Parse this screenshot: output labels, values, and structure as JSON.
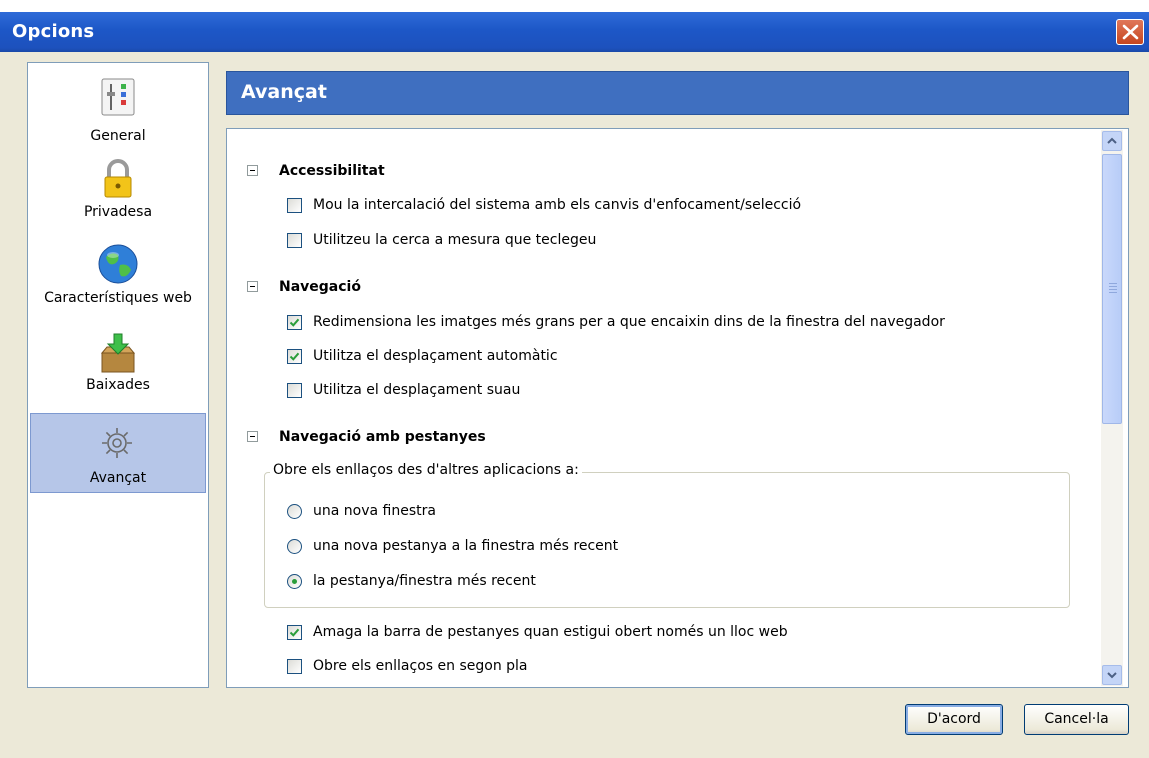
{
  "window": {
    "title": "Opcions"
  },
  "sidebar": {
    "items": [
      {
        "label": "General",
        "icon": "sliders-icon"
      },
      {
        "label": "Privadesa",
        "icon": "padlock-icon"
      },
      {
        "label": "Característiques web",
        "icon": "globe-icon"
      },
      {
        "label": "Baixades",
        "icon": "download-box-icon"
      },
      {
        "label": "Avançat",
        "icon": "gears-icon",
        "selected": true
      }
    ]
  },
  "panel": {
    "title": "Avançat",
    "sections": [
      {
        "heading": "Accessibilitat",
        "options": [
          {
            "label": "Mou la intercalació del sistema amb els canvis d'enfocament/selecció",
            "checked": false
          },
          {
            "label": "Utilitzeu la cerca a mesura que teclegeu",
            "checked": false
          }
        ]
      },
      {
        "heading": "Navegació",
        "options": [
          {
            "label": "Redimensiona les imatges més grans per a que encaixin dins de la finestra del navegador",
            "checked": true
          },
          {
            "label": "Utilitza el desplaçament automàtic",
            "checked": true
          },
          {
            "label": "Utilitza el desplaçament suau",
            "checked": false
          }
        ]
      },
      {
        "heading": "Navegació amb pestanyes",
        "group": {
          "legend": "Obre els enllaços des d'altres aplicacions a:",
          "options": [
            {
              "label": "una nova finestra",
              "selected": false
            },
            {
              "label": "una nova pestanya a la finestra més recent",
              "selected": false
            },
            {
              "label": "la pestanya/finestra més recent",
              "selected": true
            }
          ]
        },
        "options": [
          {
            "label": "Amaga la barra de pestanyes quan estigui obert només un lloc web",
            "checked": true
          },
          {
            "label": "Obre els enllaços en segon pla",
            "checked": false
          }
        ]
      }
    ]
  },
  "buttons": {
    "ok": "D'acord",
    "cancel": "Cancel·la"
  },
  "colors": {
    "titlebar": "#1d57c7",
    "header": "#3f6fc0",
    "selection": "#b6c6e8",
    "check": "#2a9d3a"
  }
}
